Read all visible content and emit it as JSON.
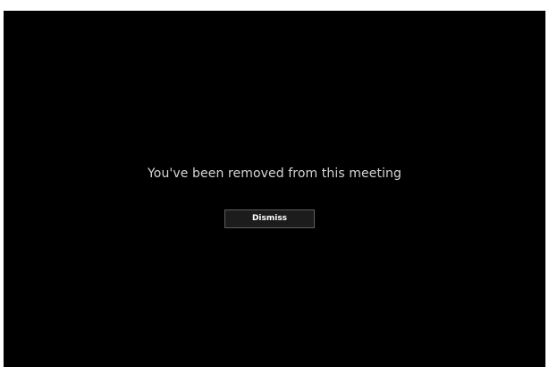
{
  "dialog": {
    "message": "You've been removed from this meeting",
    "dismiss_label": "Dismiss"
  },
  "colors": {
    "background": "#000000",
    "text": "#d6d6d6",
    "button_bg": "#1c1c1c",
    "button_border": "#5e5e5e"
  }
}
